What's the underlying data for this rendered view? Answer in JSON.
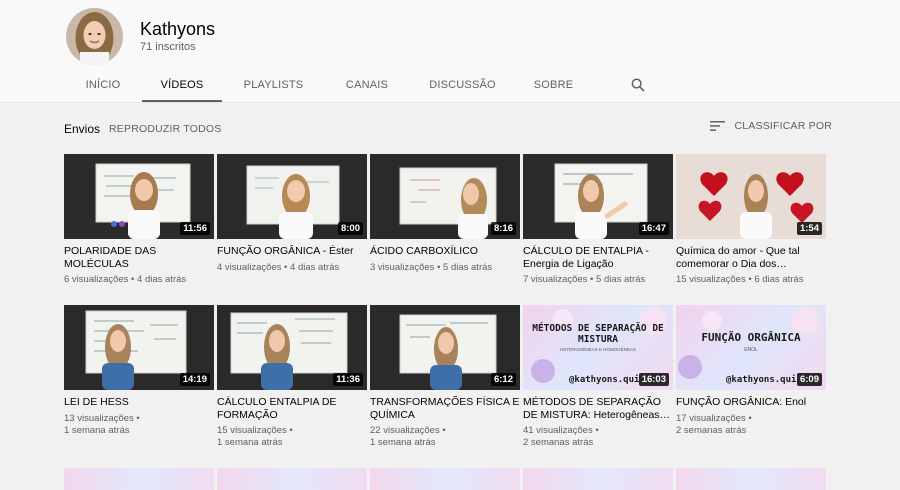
{
  "channel": {
    "name": "Kathyons",
    "subscribers": "71 inscritos"
  },
  "tabs": [
    {
      "label": "INÍCIO"
    },
    {
      "label": "VÍDEOS"
    },
    {
      "label": "PLAYLISTS"
    },
    {
      "label": "CANAIS"
    },
    {
      "label": "DISCUSSÃO"
    },
    {
      "label": "SOBRE"
    }
  ],
  "section": {
    "title": "Envios",
    "play_all": "REPRODUZIR TODOS",
    "sort_label": "CLASSIFICAR POR"
  },
  "videos": [
    {
      "title": "POLARIDADE DAS MOLÉCULAS",
      "views": "6 visualizações",
      "age": "4 dias atrás",
      "duration": "11:56"
    },
    {
      "title": "FUNÇÃO ORGÂNICA - Éster",
      "views": "4 visualizações",
      "age": "4 dias atrás",
      "duration": "8:00"
    },
    {
      "title": "ÁCIDO CARBOXÍLICO",
      "views": "3 visualizações",
      "age": "5 dias atrás",
      "duration": "8:16"
    },
    {
      "title": "CÁLCULO DE ENTALPIA - Energia de Ligação",
      "views": "7 visualizações",
      "age": "5 dias atrás",
      "duration": "16:47"
    },
    {
      "title": "Química do amor - Que tal comemorar o Dia dos…",
      "views": "15 visualizações",
      "age": "6 dias atrás",
      "duration": "1:54"
    },
    {
      "title": "LEI DE HESS",
      "views": "13 visualizações",
      "age": "1 semana atrás",
      "duration": "14:19"
    },
    {
      "title": "CÁLCULO ENTALPIA DE FORMAÇÃO",
      "views": "15 visualizações",
      "age": "1 semana atrás",
      "duration": "11:36"
    },
    {
      "title": "TRANSFORMAÇÕES FÍSICA E QUÍMICA",
      "views": "22 visualizações",
      "age": "1 semana atrás",
      "duration": "6:12"
    },
    {
      "title": "MÉTODOS DE SEPARAÇÃO DE MISTURA: Heterogêneas…",
      "views": "41 visualizações",
      "age": "2 semanas atrás",
      "duration": "16:03",
      "thumb_heading": "MÉTODOS DE SEPARAÇÃO DE MISTURA",
      "thumb_sub": "HETEROGÊNEAS E HOMOGÊNEAS",
      "thumb_handle": "@kathyons.qui"
    },
    {
      "title": "FUNÇÃO ORGÂNICA: Enol",
      "views": "17 visualizações",
      "age": "2 semanas atrás",
      "duration": "6:09",
      "thumb_heading": "FUNÇÃO ORGÂNICA",
      "thumb_sub": "ENOL",
      "thumb_handle": "@kathyons.qui"
    }
  ],
  "colors": {
    "accent": "#606060",
    "text": "#030303",
    "secondary": "#606060",
    "background": "#f1f1f1"
  }
}
